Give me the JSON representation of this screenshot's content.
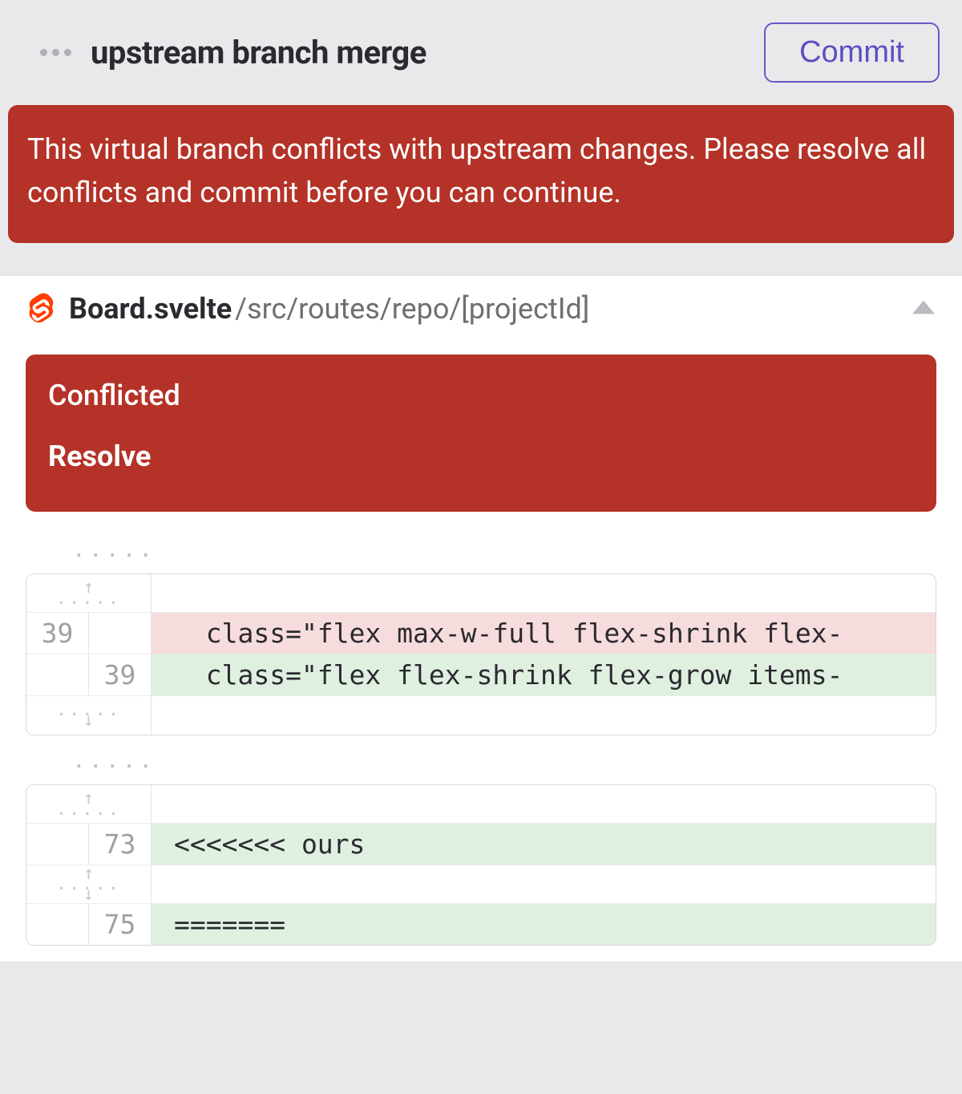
{
  "header": {
    "title": "upstream branch merge",
    "commit_label": "Commit"
  },
  "alert": {
    "message": "This virtual branch conflicts with upstream changes. Please resolve all conflicts and commit before you can continue."
  },
  "file": {
    "name": "Board.svelte",
    "path": "/src/routes/repo/[projectId]",
    "conflict_label": "Conflicted",
    "resolve_label": "Resolve"
  },
  "diff1": {
    "rows": [
      {
        "left": "",
        "right": "",
        "type": "expand-up",
        "code": ""
      },
      {
        "left": "39",
        "right": "",
        "type": "del",
        "code": "  class=\"flex max-w-full flex-shrink flex-"
      },
      {
        "left": "",
        "right": "39",
        "type": "add",
        "code": "  class=\"flex flex-shrink flex-grow items-"
      },
      {
        "left": "",
        "right": "",
        "type": "expand-down",
        "code": ""
      }
    ]
  },
  "diff2": {
    "rows": [
      {
        "left": "",
        "right": "",
        "type": "expand-up",
        "code": ""
      },
      {
        "left": "",
        "right": "73",
        "type": "add",
        "code": "<<<<<<< ours"
      },
      {
        "left": "",
        "right": "",
        "type": "expand-both",
        "code": ""
      },
      {
        "left": "",
        "right": "75",
        "type": "add",
        "code": "======="
      }
    ]
  }
}
